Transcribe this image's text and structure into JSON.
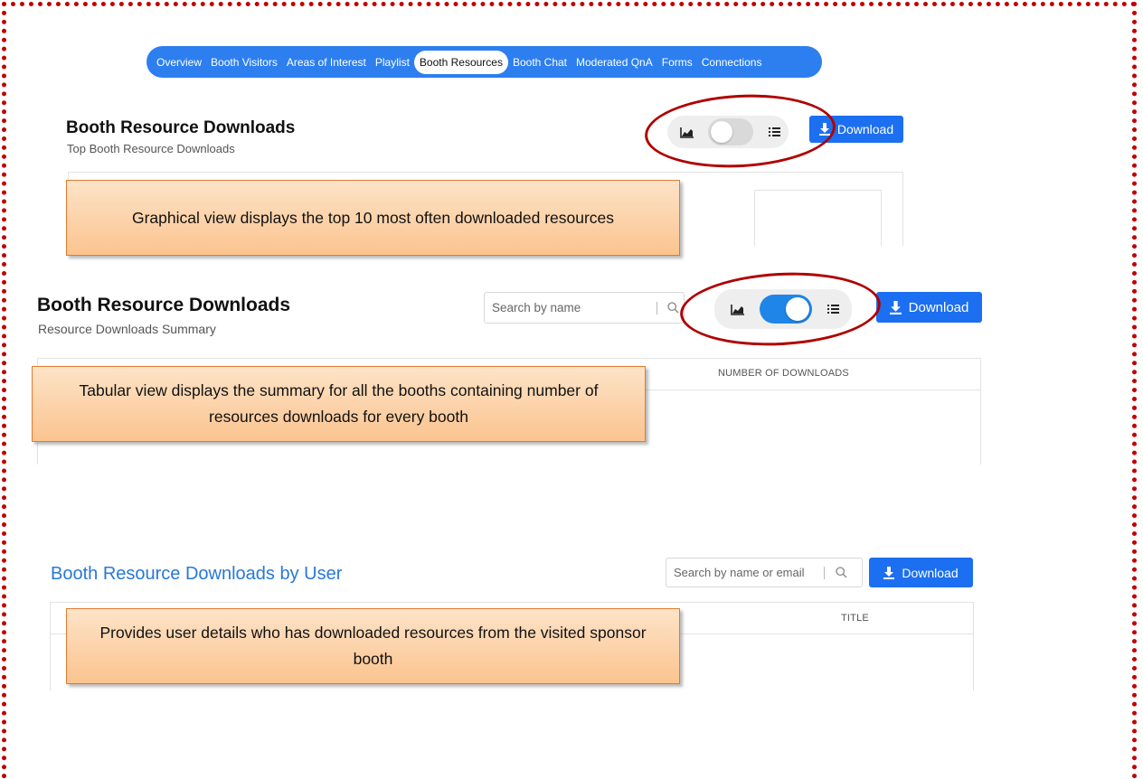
{
  "nav": {
    "items": [
      "Overview",
      "Booth Visitors",
      "Areas of Interest",
      "Playlist",
      "Booth Resources",
      "Booth Chat",
      "Moderated QnA",
      "Forms",
      "Connections"
    ],
    "active_index": 4
  },
  "graph_view": {
    "title": "Booth Resource Downloads",
    "subtitle": "Top Booth Resource Downloads",
    "toggle_state": "graph",
    "download_label": "Download",
    "callout": "Graphical view displays the top 10 most often downloaded resources"
  },
  "table_view": {
    "title": "Booth Resource Downloads",
    "subtitle": "Resource Downloads Summary",
    "search_placeholder": "Search by name",
    "toggle_state": "table",
    "download_label": "Download",
    "column_header": "NUMBER OF DOWNLOADS",
    "callout": "Tabular view displays the summary for all the booths containing number of resources downloads for every booth"
  },
  "user_view": {
    "title": "Booth Resource Downloads by User",
    "search_placeholder": "Search by name or email",
    "download_label": "Download",
    "column_header": "TITLE",
    "callout": "Provides user details who has downloaded resources from the visited sponsor booth"
  },
  "icons": [
    "chart-icon",
    "list-icon",
    "download-icon",
    "search-icon"
  ],
  "colors": {
    "accent": "#1c6ff0",
    "nav": "#2d7ff0",
    "highlight_ellipse": "#b00000",
    "frame": "#c00000",
    "callout_border": "#e07b30"
  }
}
